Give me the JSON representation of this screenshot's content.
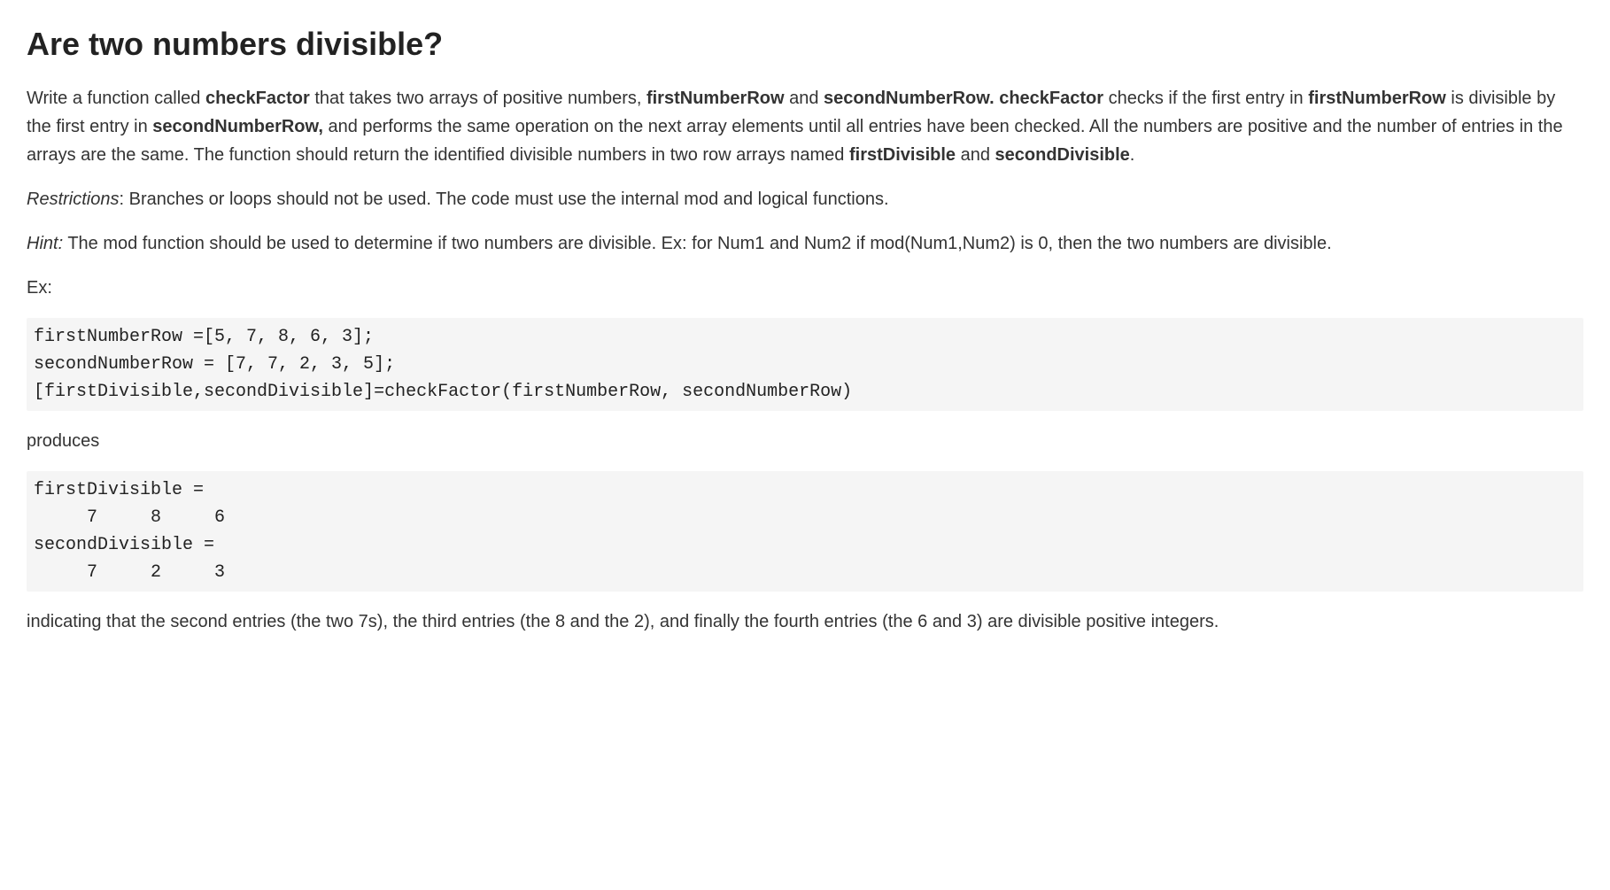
{
  "title": "Are two numbers divisible?",
  "p1": {
    "t1": "Write a function called ",
    "b1": "checkFactor",
    "t2": " that takes two arrays of positive numbers, ",
    "b2": "firstNumberRow",
    "t3": " and ",
    "b3": "secondNumberRow. checkFactor",
    "t4": " checks if the first entry in ",
    "b4": "firstNumberRow",
    "t5": " is divisible by the first entry in ",
    "b5": "secondNumberRow,",
    "t6": " and performs the same operation on the next array elements until all entries have been checked.  All the numbers are positive and the number of entries in the arrays are the same. The function should return the identified divisible numbers in two row arrays named ",
    "b6": "firstDivisible",
    "t7": " and ",
    "b7": "secondDivisible",
    "t8": "."
  },
  "p2": {
    "i1": "Restrictions",
    "t1": ": Branches or loops should not be used.  The code must use the internal mod and logical functions."
  },
  "p3": {
    "i1": "Hint:",
    "t1": "  The mod function should be used to determine if two numbers are divisible. Ex: for Num1 and Num2 if mod(Num1,Num2) is 0, then the two numbers are divisible."
  },
  "exLabel": "Ex:",
  "code1": "firstNumberRow =[5, 7, 8, 6, 3];\nsecondNumberRow = [7, 7, 2, 3, 5];\n[firstDivisible,secondDivisible]=checkFactor(firstNumberRow, secondNumberRow)",
  "produces": "produces",
  "code2": "firstDivisible =\n     7     8     6\nsecondDivisible =\n     7     2     3",
  "p4": "indicating that the second entries (the two 7s), the third entries (the 8 and the 2), and finally the fourth entries (the 6 and 3) are divisible positive integers."
}
